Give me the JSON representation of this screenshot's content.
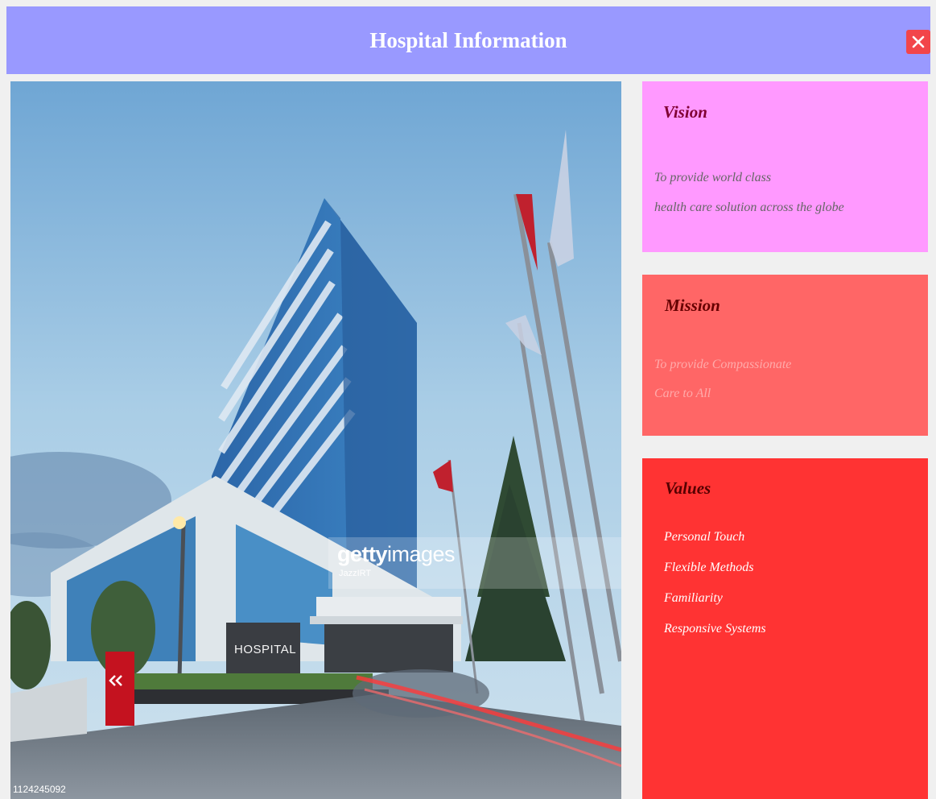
{
  "header": {
    "title": "Hospital Information",
    "close_icon": "close-icon",
    "background_color": "#9999ff",
    "close_color": "#f2454a"
  },
  "photo": {
    "sign_text": "HOSPITAL",
    "watermark_brand_bold": "getty",
    "watermark_brand_thin": "images",
    "watermark_credit": "JazzIRT",
    "image_id": "1124245092"
  },
  "vision": {
    "title": "Vision",
    "lines": [
      "To provide world class",
      "health care solution across the globe"
    ],
    "color": "#ff99ff"
  },
  "mission": {
    "title": "Mission",
    "lines": [
      "To provide Compassionate",
      "Care to All"
    ],
    "color": "#ff6666"
  },
  "values": {
    "title": "Values",
    "items": [
      "Personal Touch",
      "Flexible Methods",
      "Familiarity",
      "Responsive Systems"
    ],
    "color": "#ff3333"
  }
}
